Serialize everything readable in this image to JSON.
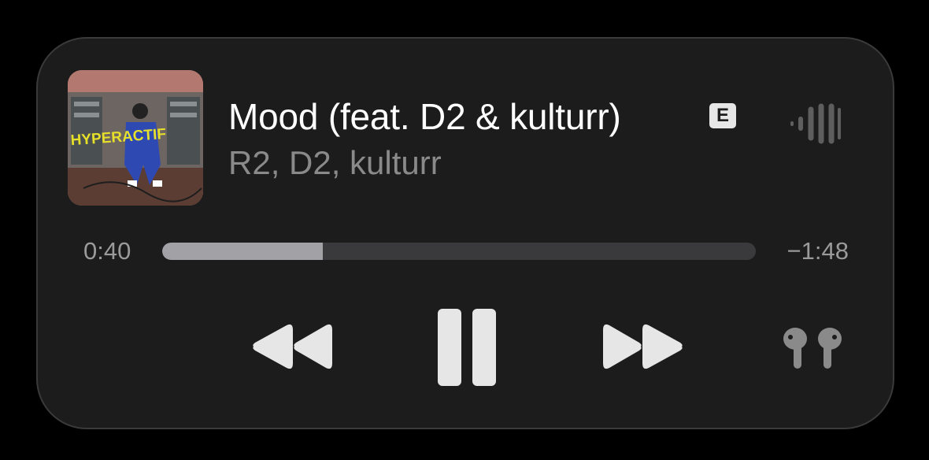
{
  "track": {
    "title": "Mood (feat. D2 & kulturr)",
    "explicit_badge": "E",
    "artists": "R2, D2, kulturr",
    "artwork_text": "HYPERACTIF"
  },
  "playback": {
    "elapsed": "0:40",
    "remaining": "−1:48",
    "progress_fraction": 0.27,
    "state": "playing"
  },
  "icons": {
    "level_meter": "audio-level-icon",
    "rewind": "backward-icon",
    "pause": "pause-icon",
    "forward": "forward-icon",
    "output_device": "airpods-icon"
  },
  "colors": {
    "background": "#1c1c1c",
    "title": "#ffffff",
    "subtitle": "#8a8a8a",
    "progress_fill": "#a1a1a6",
    "progress_track": "#3a3a3c",
    "controls": "#e6e6e6"
  }
}
